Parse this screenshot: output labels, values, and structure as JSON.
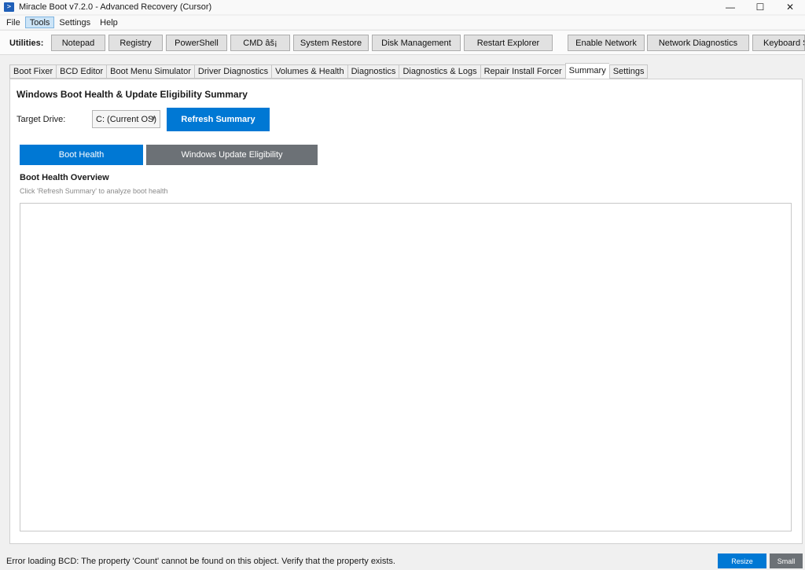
{
  "window": {
    "title": "Miracle Boot v7.2.0 - Advanced Recovery (Cursor)",
    "icon": "powershell-icon",
    "controls": {
      "minimize": "—",
      "maximize": "☐",
      "close": "✕"
    }
  },
  "menu": [
    "File",
    "Tools",
    "Settings",
    "Help"
  ],
  "menu_active": "Tools",
  "toolbar": {
    "label": "Utilities:",
    "buttons": [
      "Notepad",
      "Registry",
      "PowerShell",
      "CMD âš¡",
      "System Restore",
      "Disk Management",
      "Restart Explorer",
      "Enable Network",
      "Network Diagnostics",
      "Keyboard S"
    ]
  },
  "tabs": [
    "Boot Fixer",
    "BCD Editor",
    "Boot Menu Simulator",
    "Driver Diagnostics",
    "Volumes & Health",
    "Diagnostics",
    "Diagnostics & Logs",
    "Repair Install Forcer",
    "Summary",
    "Settings"
  ],
  "tab_active": "Summary",
  "summary": {
    "title": "Windows Boot Health & Update Eligibility Summary",
    "target_label": "Target Drive:",
    "drive_value": "C: (Current OS)",
    "refresh_label": "Refresh Summary",
    "subtabs": {
      "boot": "Boot Health",
      "wu": "Windows Update Eligibility"
    },
    "overview_title": "Boot Health Overview",
    "overview_hint": "Click 'Refresh Summary' to analyze boot health"
  },
  "status": {
    "text": "Error loading BCD: The property 'Count' cannot be found on this object. Verify that the property exists.",
    "resize_label": "Resize",
    "small_label": "Small"
  },
  "colors": {
    "accent": "#0078d4",
    "secondary": "#6c7176"
  }
}
